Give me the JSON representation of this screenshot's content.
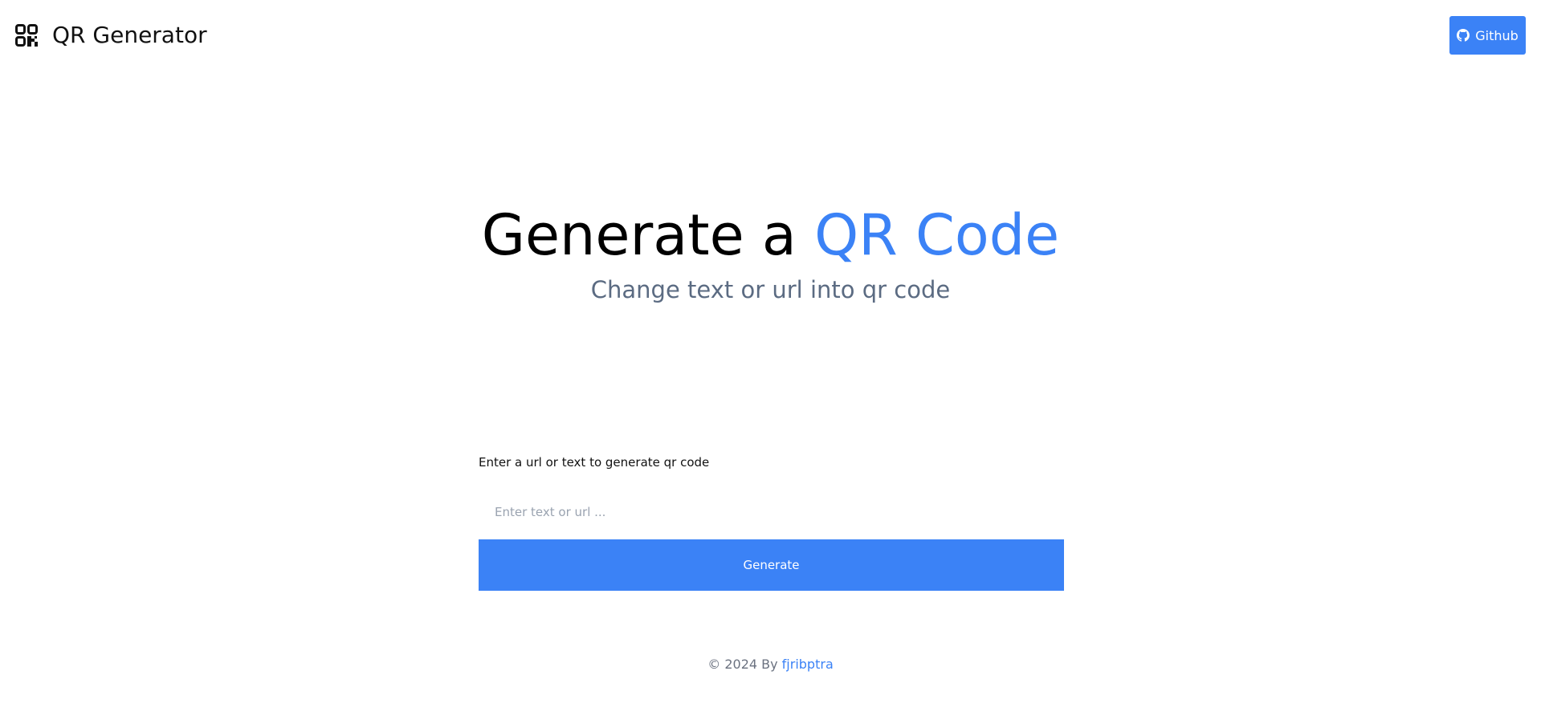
{
  "header": {
    "brand_title": "QR Generator",
    "brand_icon": "qr-code-icon",
    "github_label": "Github",
    "github_icon": "github-icon"
  },
  "hero": {
    "title_prefix": "Generate a ",
    "title_accent": "QR Code",
    "subtitle": "Change text or url into qr code"
  },
  "form": {
    "label": "Enter a url or text to generate qr code",
    "input_value": "",
    "input_placeholder": "Enter text or url ...",
    "button_label": "Generate"
  },
  "footer": {
    "copyright": "© 2024 By ",
    "author": "fjribptra"
  },
  "colors": {
    "accent": "#3b82f6",
    "subtitle": "#5b6b82",
    "footer_text": "#6b7280",
    "placeholder": "#9aa3b0"
  }
}
